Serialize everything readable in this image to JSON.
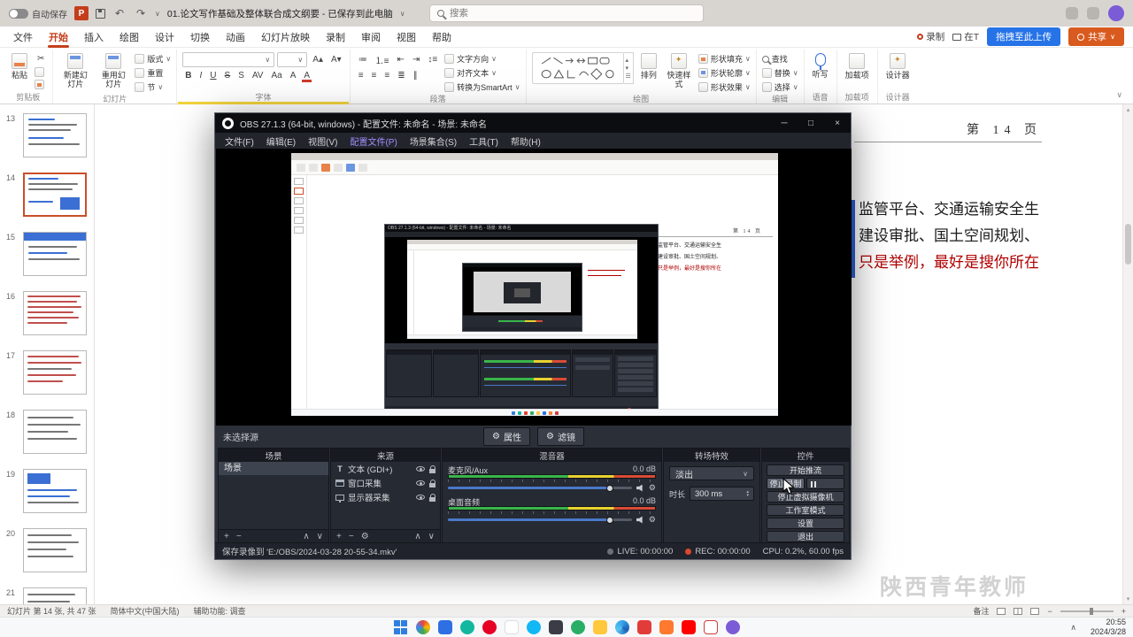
{
  "icons": {
    "plus": "+",
    "minus": "−",
    "gear": "⚙",
    "up": "∧",
    "down": "∨",
    "chevron_down": "∨",
    "undo": "↶",
    "redo": "↷",
    "spin_up": "▴",
    "spin_down": "▾"
  },
  "colors": {
    "accent_red": "#c43e1c",
    "upload_blue": "#2673e8",
    "share_orange": "#d95a1e",
    "selected_thumbnail": "#c94f2a",
    "slide_red_text": "#b00000",
    "obs_background": "#262a33",
    "recording_red": "#d9482f",
    "meter_green": "#39b54a"
  },
  "wps": {
    "titlebar": {
      "autosave_label": "自动保存",
      "app_badge": "P",
      "doc_title": "01.论文写作基础及整体联合成文纲要 - 已保存到此电脑",
      "search_placeholder": "搜索"
    },
    "tabs": [
      "文件",
      "开始",
      "插入",
      "绘图",
      "设计",
      "切换",
      "动画",
      "幻灯片放映",
      "录制",
      "审阅",
      "视图",
      "帮助"
    ],
    "quick_actions": {
      "record": "录制",
      "present": "在T",
      "upload": "拖拽至此上传",
      "share": "共享"
    },
    "ribbon": {
      "paste": "粘贴",
      "group_clipboard": "剪贴板",
      "new_slide": "新建幻灯片",
      "reuse_slides": "重用幻灯片",
      "layout": "版式",
      "reset": "重置",
      "section": "节",
      "group_slides": "幻灯片",
      "group_font": "字体",
      "text_direction": "文字方向",
      "align_text": "对齐文本",
      "smartart": "转换为SmartArt",
      "group_paragraph": "段落",
      "arrange": "排列",
      "quick_styles": "快速样式",
      "shape_fill": "形状填充",
      "shape_outline": "形状轮廓",
      "shape_effects": "形状效果",
      "group_drawing": "绘图",
      "find": "查找",
      "replace": "替换",
      "select_menu": "选择",
      "group_editing": "编辑",
      "dictate": "听写",
      "group_voice": "语音",
      "addins": "加载项",
      "group_addins": "加载项",
      "designer": "设计器",
      "group_designer": "设计器"
    },
    "slides": [
      {
        "num": "13"
      },
      {
        "num": "14"
      },
      {
        "num": "15"
      },
      {
        "num": "16"
      },
      {
        "num": "17"
      },
      {
        "num": "18"
      },
      {
        "num": "19"
      },
      {
        "num": "20"
      },
      {
        "num": "21"
      }
    ],
    "slide": {
      "page_header": "第 14 页",
      "line1": "监管平台、交通运输安全生",
      "line2": "建设审批、国土空间规划、",
      "line3": "只是举例，最好是搜你所在"
    },
    "watermark": "陕西青年教师",
    "statusbar": {
      "slide_info": "幻灯片 第 14 张, 共 47 张",
      "language": "简体中文(中国大陆)",
      "accessibility": "辅助功能: 调查",
      "notes": "备注"
    }
  },
  "obs": {
    "title": "OBS 27.1.3 (64-bit, windows) - 配置文件: 未命名 - 场景: 未命名",
    "window_controls": {
      "min": "─",
      "max": "□",
      "close": "×"
    },
    "menus": [
      "文件(F)",
      "编辑(E)",
      "视图(V)",
      "配置文件(P)",
      "场景集合(S)",
      "工具(T)",
      "帮助(H)"
    ],
    "no_source": "未选择源",
    "properties_label": "属性",
    "filters_label": "滤镜",
    "docks": {
      "scenes": {
        "title": "场景",
        "items": [
          "场景"
        ]
      },
      "sources": {
        "title": "来源",
        "items": [
          "文本 (GDI+)",
          "窗口采集",
          "显示器采集"
        ]
      },
      "mixer": {
        "title": "混音器",
        "channels": [
          {
            "name": "麦克风/Aux",
            "db": "0.0 dB"
          },
          {
            "name": "桌面音频",
            "db": "0.0 dB"
          }
        ]
      },
      "transitions": {
        "title": "转场特效",
        "transition": "淡出",
        "duration_label": "时长",
        "duration": "300 ms"
      },
      "controls": {
        "title": "控件",
        "buttons": [
          "开始推流",
          "停止录制",
          "停止虚拟摄像机",
          "工作室模式",
          "设置",
          "退出"
        ]
      }
    },
    "statusbar": {
      "recording_path": "保存录像到 'E:/OBS/2024-03-28 20-55-34.mkv'",
      "live": "LIVE: 00:00:00",
      "rec": "REC: 00:00:00",
      "stats": "CPU: 0.2%, 60.00 fps"
    }
  },
  "taskbar": {
    "time": "20:55",
    "date": "2024/3/28"
  }
}
